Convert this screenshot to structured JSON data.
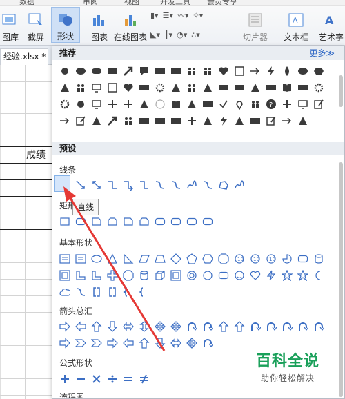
{
  "menu": {
    "items": [
      "数据",
      "审阅",
      "视图",
      "开发工具",
      "会员专享"
    ]
  },
  "ribbon": {
    "buttons": {
      "gallery": "图库",
      "screenshot": "截屏",
      "shapes": "形状",
      "chart": "图表",
      "online_chart": "在线图表",
      "slicer": "切片器",
      "textbox": "文本框",
      "art_text": "艺术字"
    }
  },
  "tabbar": {
    "doc_tab": "经验.xlsx *"
  },
  "sheet": {
    "score_header": "成绩"
  },
  "panel": {
    "recommended_label": "推荐",
    "more_link": "更多≫",
    "preset_label": "预设",
    "categories": {
      "lines": "线条",
      "rectangles": "矩形",
      "basic_shapes": "基本形状",
      "block_arrows": "箭头总汇",
      "equation_shapes": "公式形状",
      "flowchart": "流程图"
    },
    "tooltip": "直线"
  },
  "watermark": {
    "title": "百科全说",
    "subtitle": "助你轻松解决"
  },
  "colors": {
    "shape_outline": "#3d6fc4",
    "shape_fill_dark": "#3a3a3a",
    "active_button": "#cfe0f6",
    "arrow_red": "#e53935",
    "watermark_green": "#1aa05a"
  }
}
